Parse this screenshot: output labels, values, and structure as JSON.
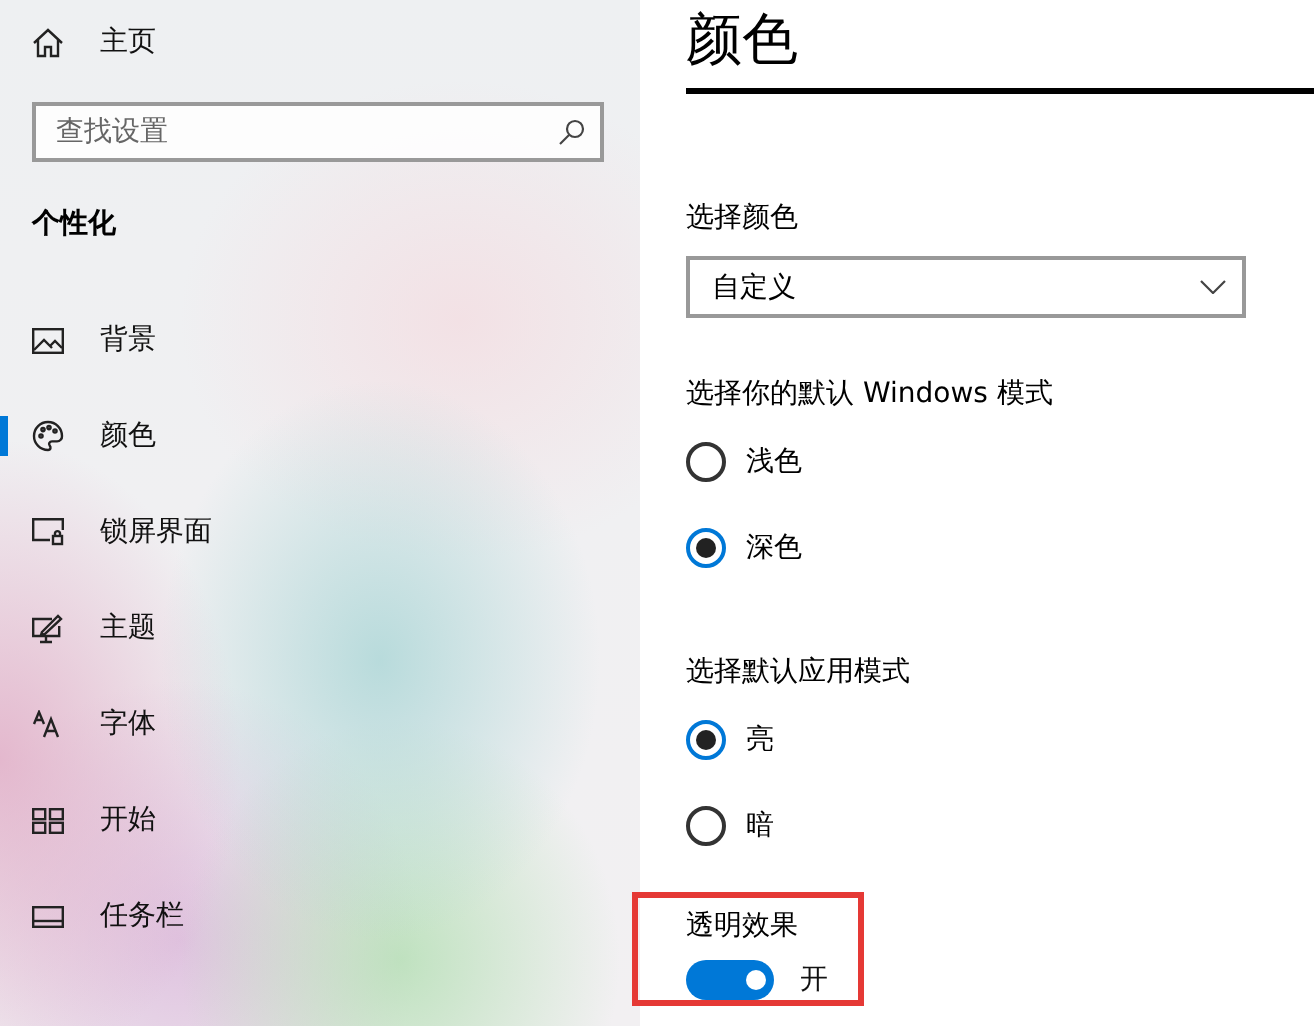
{
  "sidebar": {
    "home": "主页",
    "search": {
      "placeholder": "查找设置"
    },
    "section": "个性化",
    "items": [
      {
        "label": "背景",
        "selected": false
      },
      {
        "label": "颜色",
        "selected": true
      },
      {
        "label": "锁屏界面",
        "selected": false
      },
      {
        "label": "主题",
        "selected": false
      },
      {
        "label": "字体",
        "selected": false
      },
      {
        "label": "开始",
        "selected": false
      },
      {
        "label": "任务栏",
        "selected": false
      }
    ]
  },
  "page": {
    "title": "颜色",
    "color_choice": {
      "label": "选择颜色",
      "value": "自定义"
    },
    "groups": [
      {
        "label": "选择你的默认 Windows 模式",
        "options": [
          {
            "label": "浅色",
            "selected": false
          },
          {
            "label": "深色",
            "selected": true
          }
        ]
      },
      {
        "label": "选择默认应用模式",
        "options": [
          {
            "label": "亮",
            "selected": true
          },
          {
            "label": "暗",
            "selected": false
          }
        ]
      }
    ],
    "transparency": {
      "label": "透明效果",
      "on": true,
      "state_text": "开"
    }
  }
}
